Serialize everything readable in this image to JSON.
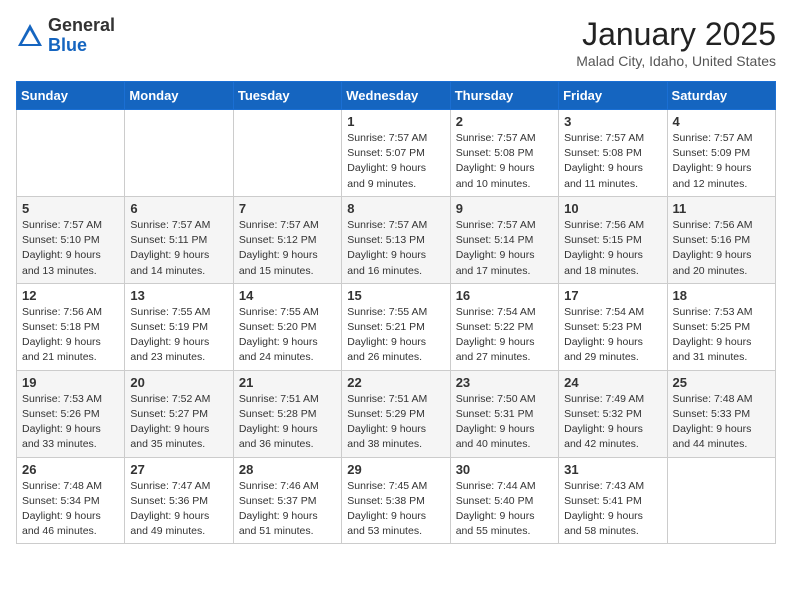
{
  "logo": {
    "general": "General",
    "blue": "Blue"
  },
  "header": {
    "month": "January 2025",
    "location": "Malad City, Idaho, United States"
  },
  "weekdays": [
    "Sunday",
    "Monday",
    "Tuesday",
    "Wednesday",
    "Thursday",
    "Friday",
    "Saturday"
  ],
  "weeks": [
    [
      {
        "day": "",
        "info": ""
      },
      {
        "day": "",
        "info": ""
      },
      {
        "day": "",
        "info": ""
      },
      {
        "day": "1",
        "info": "Sunrise: 7:57 AM\nSunset: 5:07 PM\nDaylight: 9 hours\nand 9 minutes."
      },
      {
        "day": "2",
        "info": "Sunrise: 7:57 AM\nSunset: 5:08 PM\nDaylight: 9 hours\nand 10 minutes."
      },
      {
        "day": "3",
        "info": "Sunrise: 7:57 AM\nSunset: 5:08 PM\nDaylight: 9 hours\nand 11 minutes."
      },
      {
        "day": "4",
        "info": "Sunrise: 7:57 AM\nSunset: 5:09 PM\nDaylight: 9 hours\nand 12 minutes."
      }
    ],
    [
      {
        "day": "5",
        "info": "Sunrise: 7:57 AM\nSunset: 5:10 PM\nDaylight: 9 hours\nand 13 minutes."
      },
      {
        "day": "6",
        "info": "Sunrise: 7:57 AM\nSunset: 5:11 PM\nDaylight: 9 hours\nand 14 minutes."
      },
      {
        "day": "7",
        "info": "Sunrise: 7:57 AM\nSunset: 5:12 PM\nDaylight: 9 hours\nand 15 minutes."
      },
      {
        "day": "8",
        "info": "Sunrise: 7:57 AM\nSunset: 5:13 PM\nDaylight: 9 hours\nand 16 minutes."
      },
      {
        "day": "9",
        "info": "Sunrise: 7:57 AM\nSunset: 5:14 PM\nDaylight: 9 hours\nand 17 minutes."
      },
      {
        "day": "10",
        "info": "Sunrise: 7:56 AM\nSunset: 5:15 PM\nDaylight: 9 hours\nand 18 minutes."
      },
      {
        "day": "11",
        "info": "Sunrise: 7:56 AM\nSunset: 5:16 PM\nDaylight: 9 hours\nand 20 minutes."
      }
    ],
    [
      {
        "day": "12",
        "info": "Sunrise: 7:56 AM\nSunset: 5:18 PM\nDaylight: 9 hours\nand 21 minutes."
      },
      {
        "day": "13",
        "info": "Sunrise: 7:55 AM\nSunset: 5:19 PM\nDaylight: 9 hours\nand 23 minutes."
      },
      {
        "day": "14",
        "info": "Sunrise: 7:55 AM\nSunset: 5:20 PM\nDaylight: 9 hours\nand 24 minutes."
      },
      {
        "day": "15",
        "info": "Sunrise: 7:55 AM\nSunset: 5:21 PM\nDaylight: 9 hours\nand 26 minutes."
      },
      {
        "day": "16",
        "info": "Sunrise: 7:54 AM\nSunset: 5:22 PM\nDaylight: 9 hours\nand 27 minutes."
      },
      {
        "day": "17",
        "info": "Sunrise: 7:54 AM\nSunset: 5:23 PM\nDaylight: 9 hours\nand 29 minutes."
      },
      {
        "day": "18",
        "info": "Sunrise: 7:53 AM\nSunset: 5:25 PM\nDaylight: 9 hours\nand 31 minutes."
      }
    ],
    [
      {
        "day": "19",
        "info": "Sunrise: 7:53 AM\nSunset: 5:26 PM\nDaylight: 9 hours\nand 33 minutes."
      },
      {
        "day": "20",
        "info": "Sunrise: 7:52 AM\nSunset: 5:27 PM\nDaylight: 9 hours\nand 35 minutes."
      },
      {
        "day": "21",
        "info": "Sunrise: 7:51 AM\nSunset: 5:28 PM\nDaylight: 9 hours\nand 36 minutes."
      },
      {
        "day": "22",
        "info": "Sunrise: 7:51 AM\nSunset: 5:29 PM\nDaylight: 9 hours\nand 38 minutes."
      },
      {
        "day": "23",
        "info": "Sunrise: 7:50 AM\nSunset: 5:31 PM\nDaylight: 9 hours\nand 40 minutes."
      },
      {
        "day": "24",
        "info": "Sunrise: 7:49 AM\nSunset: 5:32 PM\nDaylight: 9 hours\nand 42 minutes."
      },
      {
        "day": "25",
        "info": "Sunrise: 7:48 AM\nSunset: 5:33 PM\nDaylight: 9 hours\nand 44 minutes."
      }
    ],
    [
      {
        "day": "26",
        "info": "Sunrise: 7:48 AM\nSunset: 5:34 PM\nDaylight: 9 hours\nand 46 minutes."
      },
      {
        "day": "27",
        "info": "Sunrise: 7:47 AM\nSunset: 5:36 PM\nDaylight: 9 hours\nand 49 minutes."
      },
      {
        "day": "28",
        "info": "Sunrise: 7:46 AM\nSunset: 5:37 PM\nDaylight: 9 hours\nand 51 minutes."
      },
      {
        "day": "29",
        "info": "Sunrise: 7:45 AM\nSunset: 5:38 PM\nDaylight: 9 hours\nand 53 minutes."
      },
      {
        "day": "30",
        "info": "Sunrise: 7:44 AM\nSunset: 5:40 PM\nDaylight: 9 hours\nand 55 minutes."
      },
      {
        "day": "31",
        "info": "Sunrise: 7:43 AM\nSunset: 5:41 PM\nDaylight: 9 hours\nand 58 minutes."
      },
      {
        "day": "",
        "info": ""
      }
    ]
  ]
}
